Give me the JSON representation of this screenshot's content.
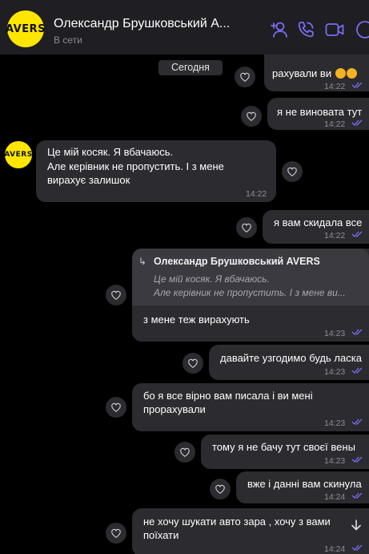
{
  "header": {
    "avatar_text": "AVERS",
    "contact_name": "Олександр Брушковський A...",
    "status": "В сети"
  },
  "icons": {
    "add_contact": "add-user-icon",
    "call": "phone-icon",
    "video": "video-icon",
    "menu": "more-options-icon"
  },
  "colors": {
    "accent": "#7b6cf0",
    "bubble": "#2b2b30",
    "avatar_bg": "#ffe600",
    "header_bg": "#1e1e23"
  },
  "chat": {
    "date_label": "Сегодня",
    "messages": [
      {
        "from": "me",
        "lines": [
          "рахували ви"
        ],
        "emoji": "😩😩",
        "time": "14:22",
        "read": true
      },
      {
        "from": "me",
        "lines": [
          "я не виновата тут"
        ],
        "time": "14:22",
        "read": true
      },
      {
        "from": "contact",
        "lines": [
          "Це мій косяк. Я вбачаюсь.",
          "Але керівник не пропустить.  І з мене",
          "вирахує залишок"
        ],
        "time": "14:22"
      },
      {
        "from": "me",
        "lines": [
          "я вам скидала все"
        ],
        "time": "14:22",
        "read": true
      },
      {
        "from": "me",
        "reply": {
          "author": "Олександр Брушковський AVERS",
          "line1": "Це мій косяк. Я вбачаюсь.",
          "line2": "Але керівник не пропустить.  І з мене ви..."
        },
        "lines": [
          "з мене теж вирахують"
        ],
        "time": "14:23",
        "read": true
      },
      {
        "from": "me",
        "lines": [
          "давайте узгодимо будь ласка"
        ],
        "time": "14:23",
        "read": true
      },
      {
        "from": "me",
        "lines": [
          "бо я все вірно вам писала і ви мені",
          "прорахували"
        ],
        "time": "14:23",
        "read": true
      },
      {
        "from": "me",
        "lines": [
          "тому я не бачу  тут своєї вены"
        ],
        "time": "14:23",
        "read": true
      },
      {
        "from": "me",
        "lines": [
          "вже і данні вам скинула"
        ],
        "time": "14:24",
        "read": true
      },
      {
        "from": "me",
        "lines": [
          "не хочу шукати авто зара  , хочу з вами",
          "поїхати"
        ],
        "time": "14:24",
        "read": true
      }
    ]
  }
}
